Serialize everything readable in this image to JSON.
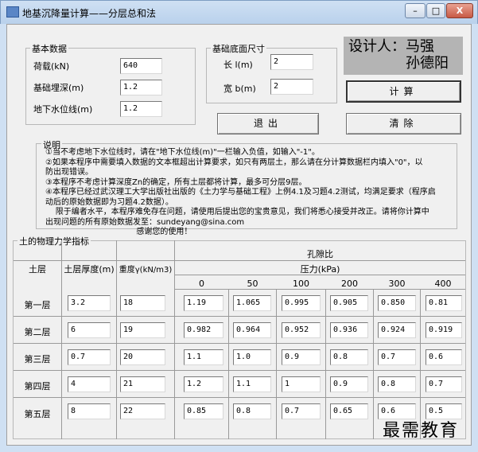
{
  "window": {
    "title": "地基沉降量计算——分层总和法",
    "minimize_label": "–",
    "maximize_label": "□",
    "close_label": "X"
  },
  "basic_data": {
    "title": "基本数据",
    "load_label": "荷载(kN)",
    "load_value": "640",
    "depth_label": "基础埋深(m)",
    "depth_value": "1.2",
    "water_label": "地下水位线(m)",
    "water_value": "1.2"
  },
  "base_size": {
    "title": "基础底面尺寸",
    "length_label": "长 l(m)",
    "length_value": "2",
    "width_label": "宽 b(m)",
    "width_value": "2"
  },
  "designer": {
    "line1": "设计人：马强",
    "line2": "孙德阳"
  },
  "buttons": {
    "calculate": "计算",
    "exit": "退出",
    "clear": "清除"
  },
  "notes": {
    "title": "说明",
    "text": "①当不考虑地下水位线时，请在\"地下水位线(m)\"一栏输入负值，如输入\"-1\"。\n②如果本程序中需要填入数据的文本框超出计算要求，如只有两层土，那么请在分计算数据栏内填入\"0\"，以\n防出现错误。\n③本程序不考虑计算深度Zn的确定，所有土层都将计算，最多可分层9层。\n④本程序已经过武汉理工大学出版社出版的《土力学与基础工程》上例4.1及习题4.2测试，均满足要求（程序启\n动后的原始数据即为习题4.2数据）。\n    限于编者水平，本程序难免存在问题，请使用后提出您的宝贵意见，我们将悉心接受并改正。请将你计算中\n出现问题的所有原始数据发至：sundeyang@sina.com\n                                    感谢您的使用！"
  },
  "soil_table": {
    "title": "土的物理力学指标",
    "header_layer": "土层",
    "header_thickness": "土层厚度(m)",
    "header_gamma": "重度γ(kN/m3)",
    "header_void": "孔隙比",
    "header_pressure": "压力(kPa)",
    "pressures": [
      "0",
      "50",
      "100",
      "200",
      "300",
      "400"
    ],
    "rows": [
      {
        "name": "第一层",
        "thickness": "3.2",
        "gamma": "18",
        "e": [
          "1.19",
          "1.065",
          "0.995",
          "0.905",
          "0.850",
          "0.81"
        ]
      },
      {
        "name": "第二层",
        "thickness": "6",
        "gamma": "19",
        "e": [
          "0.982",
          "0.964",
          "0.952",
          "0.936",
          "0.924",
          "0.919"
        ]
      },
      {
        "name": "第三层",
        "thickness": "0.7",
        "gamma": "20",
        "e": [
          "1.1",
          "1.0",
          "0.9",
          "0.8",
          "0.7",
          "0.6"
        ]
      },
      {
        "name": "第四层",
        "thickness": "4",
        "gamma": "21",
        "e": [
          "1.2",
          "1.1",
          "1",
          "0.9",
          "0.8",
          "0.7"
        ]
      },
      {
        "name": "第五层",
        "thickness": "8",
        "gamma": "22",
        "e": [
          "0.85",
          "0.8",
          "0.7",
          "0.65",
          "0.6",
          "0.5"
        ]
      }
    ]
  },
  "watermark": "最需教育"
}
